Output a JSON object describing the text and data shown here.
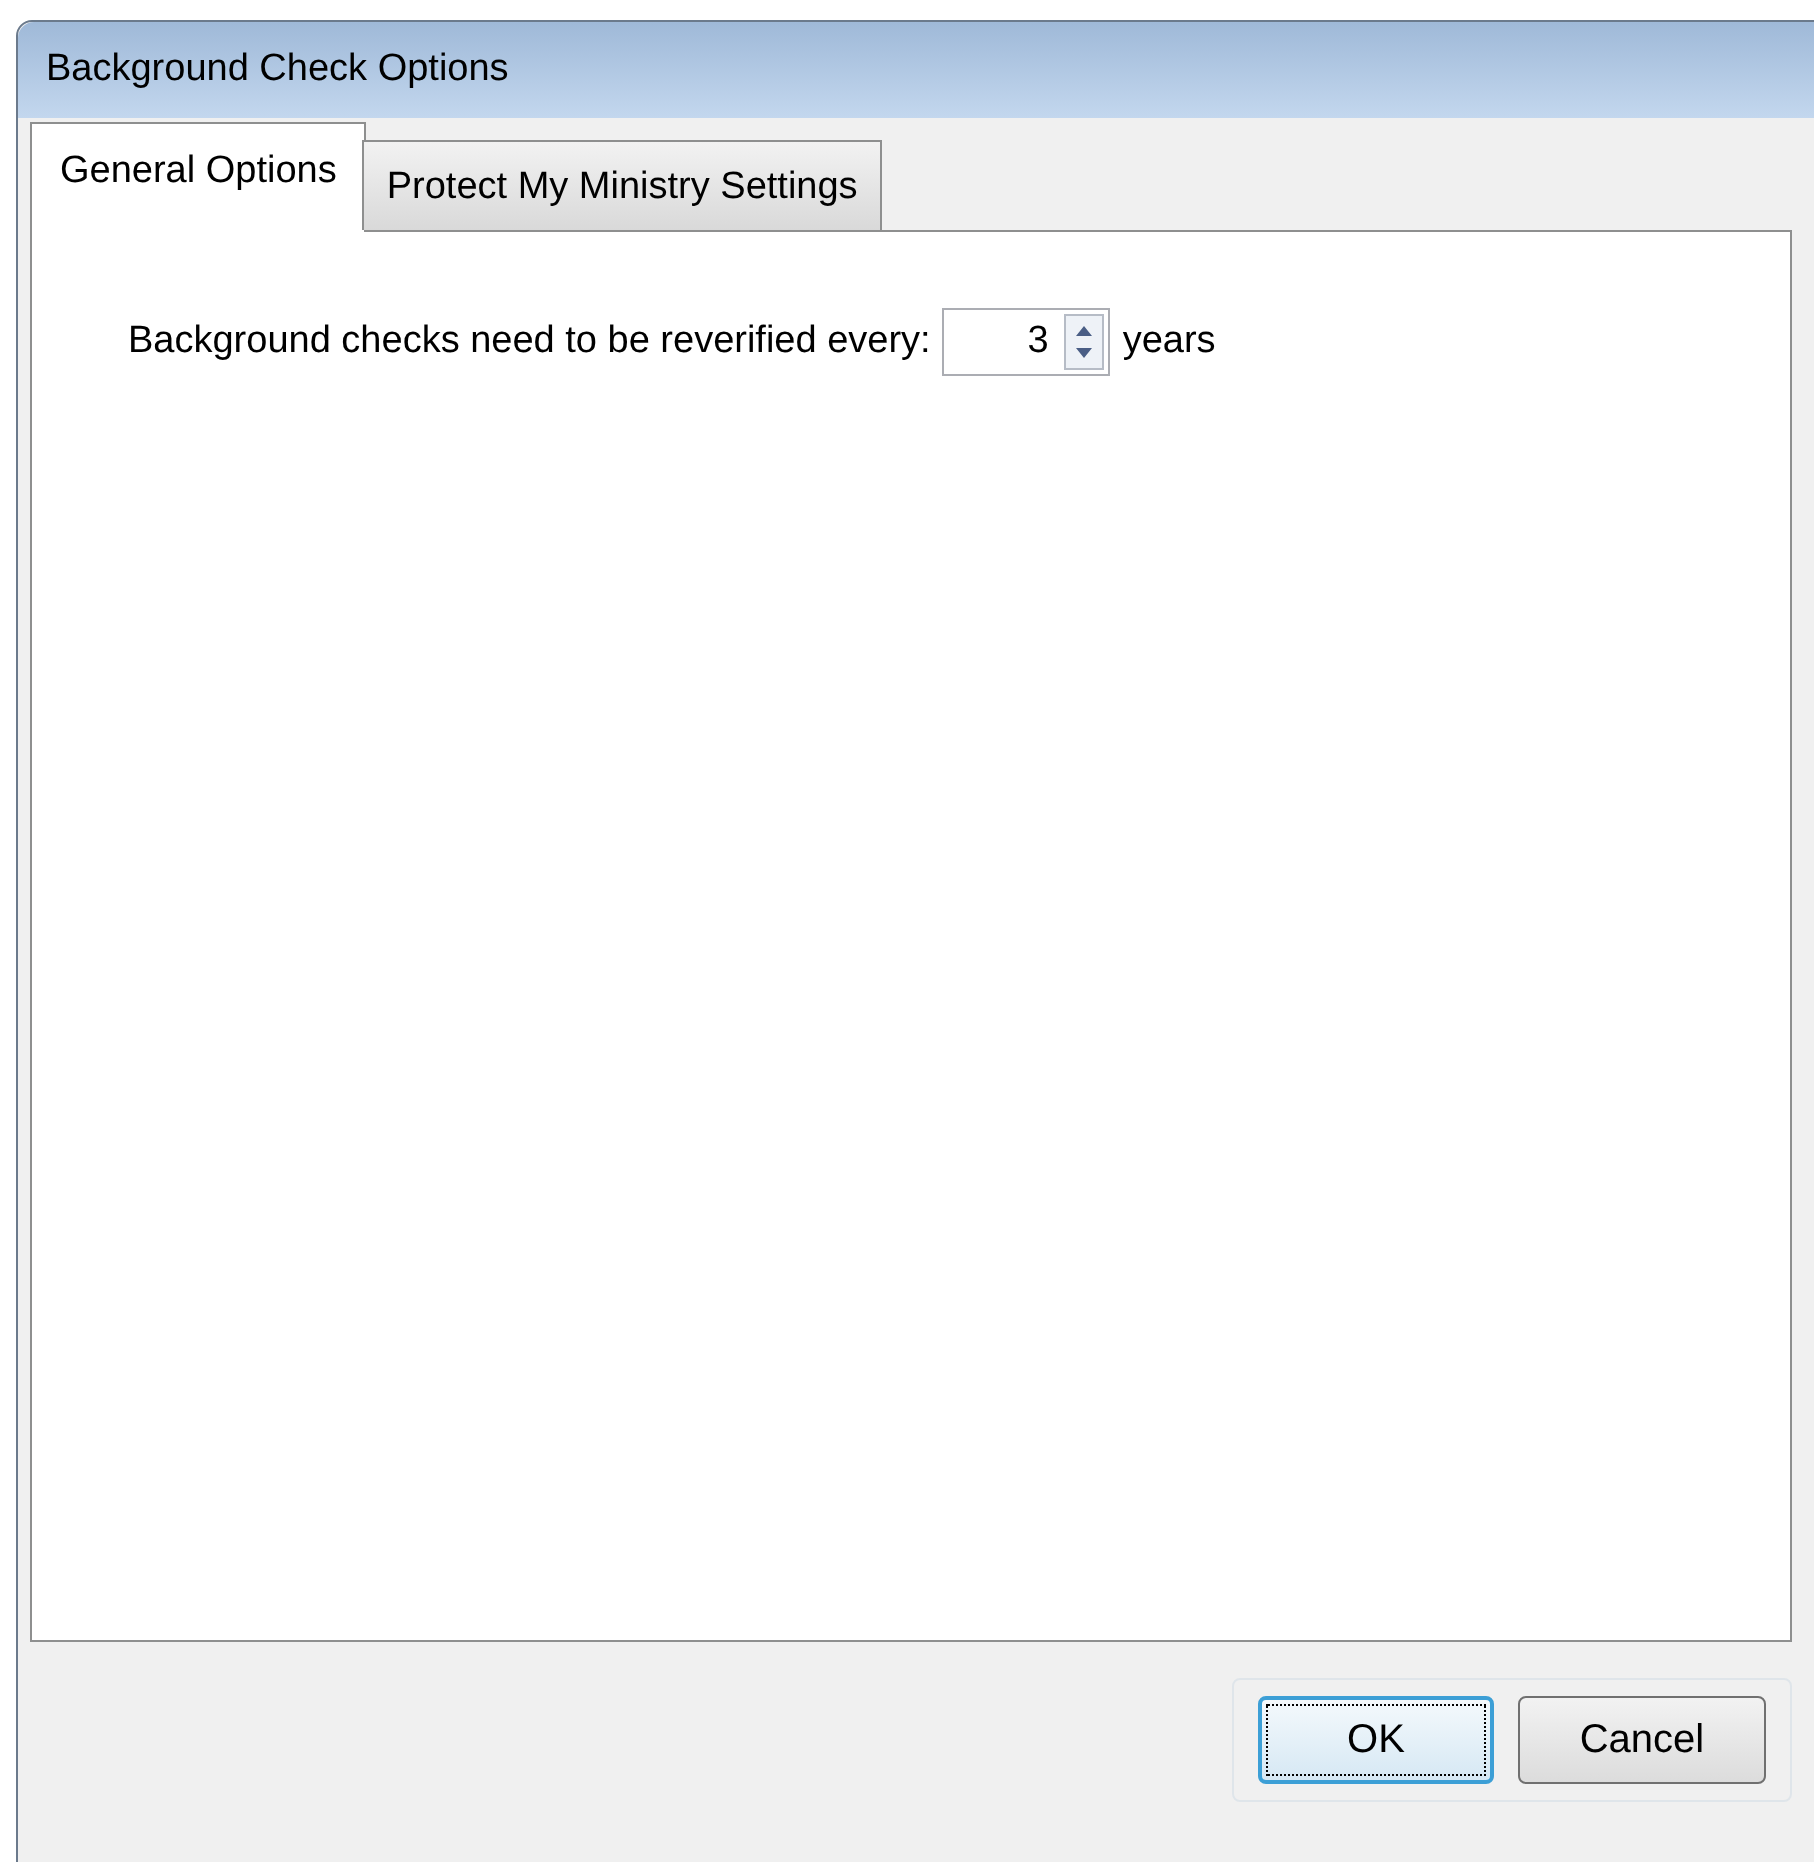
{
  "window": {
    "title": "Background Check Options"
  },
  "tabs": [
    {
      "label": "General Options",
      "selected": true
    },
    {
      "label": "Protect My Ministry Settings",
      "selected": false
    }
  ],
  "reverify": {
    "label": "Background checks need to be reverified every:",
    "value": "3",
    "unit": "years"
  },
  "buttons": [
    {
      "label": "OK",
      "focused": true
    },
    {
      "label": "Cancel",
      "focused": false
    }
  ]
}
